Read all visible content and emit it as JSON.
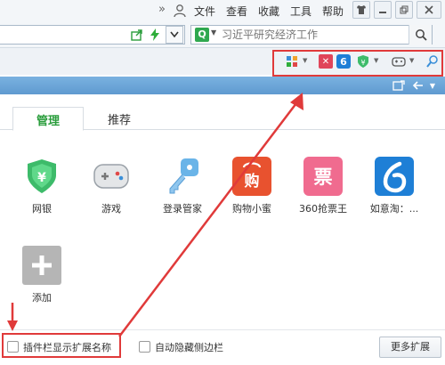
{
  "menubar": {
    "chevron": "»",
    "items": [
      "文件",
      "查看",
      "收藏",
      "工具",
      "帮助"
    ],
    "window_buttons": [
      "shirt-icon",
      "minimize-icon",
      "restore-icon",
      "close-icon"
    ]
  },
  "search": {
    "engine_letter": "Q",
    "placeholder": "习近平研究经济工作"
  },
  "toolbar_icons": [
    "apps-grid-icon",
    "red-square-icon",
    "blue-6-icon",
    "shield-yen-icon",
    "gamepad-icon",
    "magnifier-icon"
  ],
  "tabs": [
    {
      "label": "管理",
      "active": true
    },
    {
      "label": "推荐",
      "active": false
    }
  ],
  "extensions": [
    {
      "label": "网银",
      "icon": "shield-yen-icon",
      "color": "#3dbb6a"
    },
    {
      "label": "游戏",
      "icon": "gamepad-icon",
      "color": "#e4e6e8"
    },
    {
      "label": "登录管家",
      "icon": "key-icon",
      "color": "#6ab4e8"
    },
    {
      "label": "购物小蜜",
      "icon": "shopping-bag-icon",
      "color": "#e8522f"
    },
    {
      "label": "360抢票王",
      "icon": "ticket-icon",
      "color": "#f06b8f"
    },
    {
      "label": "如意淘：...",
      "icon": "blue-6-icon",
      "color": "#1e7fd6"
    },
    {
      "label": "添加",
      "icon": "plus-icon",
      "color": "#b5b5b5"
    }
  ],
  "bottom": {
    "show_names_label": "插件栏显示扩展名称",
    "auto_hide_label": "自动隐藏侧边栏",
    "more_button": "更多扩展"
  },
  "colors": {
    "accent_green": "#2a9d3c",
    "highlight_red": "#e03a3a",
    "band_blue": "#6aa6dc"
  }
}
